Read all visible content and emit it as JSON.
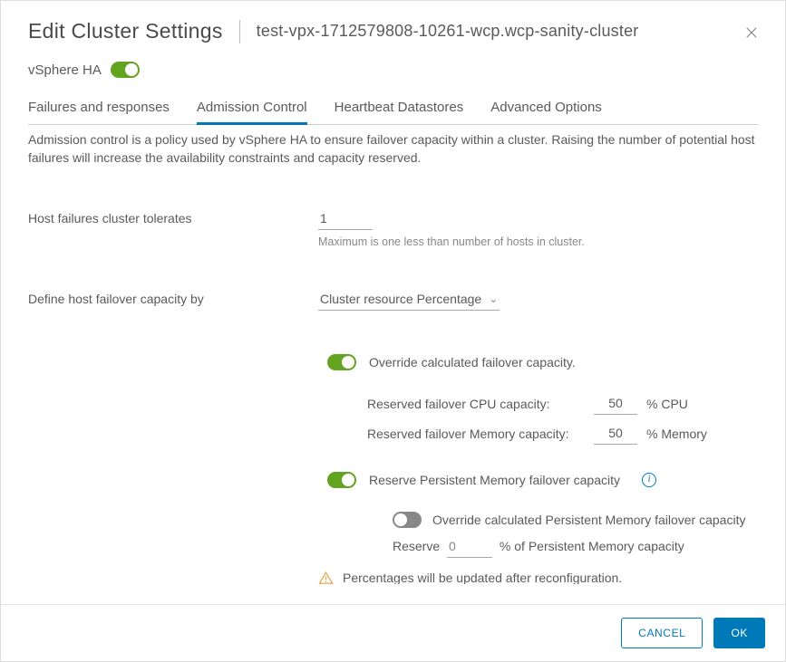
{
  "header": {
    "title": "Edit Cluster Settings",
    "subtitle": "test-vpx-1712579808-10261-wcp.wcp-sanity-cluster"
  },
  "ha": {
    "label": "vSphere HA",
    "enabled": true
  },
  "tabs": {
    "items": [
      {
        "label": "Failures and responses",
        "active": false
      },
      {
        "label": "Admission Control",
        "active": true
      },
      {
        "label": "Heartbeat Datastores",
        "active": false
      },
      {
        "label": "Advanced Options",
        "active": false
      }
    ]
  },
  "description": "Admission control is a policy used by vSphere HA to ensure failover capacity within a cluster. Raising the number of potential host failures will increase the availability constraints and capacity reserved.",
  "hostFailures": {
    "label": "Host failures cluster tolerates",
    "value": "1",
    "help": "Maximum is one less than number of hosts in cluster."
  },
  "failoverCapacity": {
    "label": "Define host failover capacity by",
    "selected": "Cluster resource Percentage",
    "override": {
      "on": true,
      "label": "Override calculated failover capacity."
    },
    "cpu": {
      "label": "Reserved failover CPU capacity:",
      "value": "50",
      "unit": "% CPU"
    },
    "mem": {
      "label": "Reserved failover Memory capacity:",
      "value": "50",
      "unit": "% Memory"
    },
    "pmem": {
      "on": true,
      "label": "Reserve Persistent Memory failover capacity",
      "override": {
        "on": false,
        "label": "Override calculated Persistent Memory failover capacity"
      },
      "reserveLabel": "Reserve",
      "reserveValue": "0",
      "reserveSuffix": "% of Persistent Memory capacity"
    },
    "warning": "Percentages will be updated after reconfiguration."
  },
  "footer": {
    "cancel": "Cancel",
    "ok": "OK"
  }
}
